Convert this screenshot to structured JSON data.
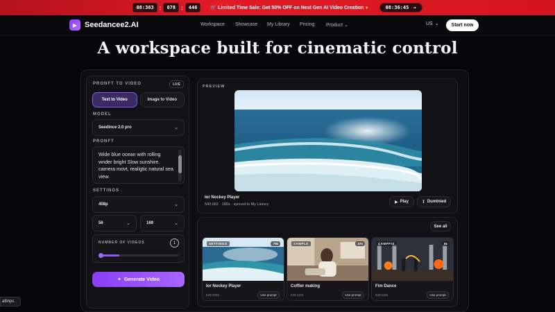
{
  "promo": {
    "timer": [
      "08:363",
      "078",
      "446"
    ],
    "sale_text": "Limited Time Sale: Get 50% OFF on Next Gen AI Video Creation",
    "countdown": "08:36:45",
    "countdown_arrow": "→",
    "cart_icon": "cart-icon",
    "fire_icon": "fire-icon"
  },
  "nav": {
    "brand": "Seedancee2.AI",
    "items": [
      "Workspace",
      "Showcase",
      "My Library",
      "Pricing",
      "Product"
    ],
    "lang": "US",
    "start": "Start now"
  },
  "hero": {
    "title": "A workspace built for cinematic control"
  },
  "panel": {
    "section_label": "PRONFT TO VIDEO",
    "live": "LIVE",
    "mode_text": "Text to Video",
    "mode_image": "Image to Video",
    "model_label": "MODEL",
    "model_value": "Seedince 2.0 pro",
    "prompt_label": "PRONFT",
    "prompt_text": "Wide blue ocean with rolling wnder bright Slow sunshire. camera movt, realigtic natural sea view.",
    "settings_label": "SETTINGS",
    "resolution": "408p",
    "duration": "56",
    "ratio": "169",
    "num_label": "NUMBER OF VIDEOS",
    "num_value": "1",
    "num_fraction": 0.25,
    "generate": "Generate Video",
    "corner_text": "altinpc"
  },
  "preview": {
    "label": "PREVIEW",
    "title": "Ior Nockey Player",
    "meta": "540.682 · 180s · synced to My Linrery",
    "play": "Play",
    "download": "Dumlnied"
  },
  "gallery": {
    "see_all": "See all",
    "cards": [
      {
        "tag": "SETTINGS",
        "duration": "70k",
        "title": "Ior Nockey Player",
        "meta": "540:1050",
        "use": "Use prompt"
      },
      {
        "tag": "SAMPLE",
        "duration": "37s",
        "title": "Coffier making",
        "meta": "540:1163",
        "use": "Use prompt"
      },
      {
        "tag": "CAMPFIS",
        "duration": "9s",
        "title": "Fim Dance",
        "meta": "540:1165",
        "use": "Use prompt"
      }
    ]
  },
  "colors": {
    "accent": "#8b5cf6",
    "promo": "#e01b26"
  }
}
